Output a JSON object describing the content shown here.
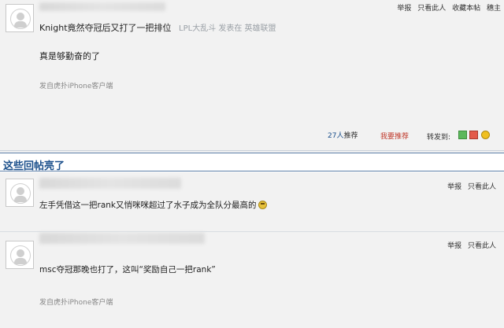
{
  "post1": {
    "actions": [
      "举报",
      "只看此人",
      "收藏本帖",
      "穗主"
    ],
    "title": "Knight竟然夺冠后又打了一把排位",
    "subtitle": "LPL大乱斗 发表在 英雄联盟",
    "body": "真是够勤奋的了",
    "source": "发自虎扑iPhone客户端",
    "recommend_count": "27人",
    "recommend_label": "推荐",
    "my_recommend": "我要推荐",
    "share_label": "转发到:",
    "colors": {
      "my_recommend": "#c0392b",
      "count": "#1a4f8b"
    }
  },
  "section": {
    "title": "这些回帖亮了",
    "color": "#1a4f8b"
  },
  "replies": [
    {
      "actions": [
        "举报",
        "只看此人"
      ],
      "text": "左手凭借这一把rank又悄咪咪超过了水子成为全队分最高的"
    },
    {
      "actions": [
        "举报",
        "只看此人"
      ],
      "text": "msc夺冠那晚也打了，这叫“奖励自己一把rank”",
      "source": "发自虎扑iPhone客户端"
    }
  ]
}
